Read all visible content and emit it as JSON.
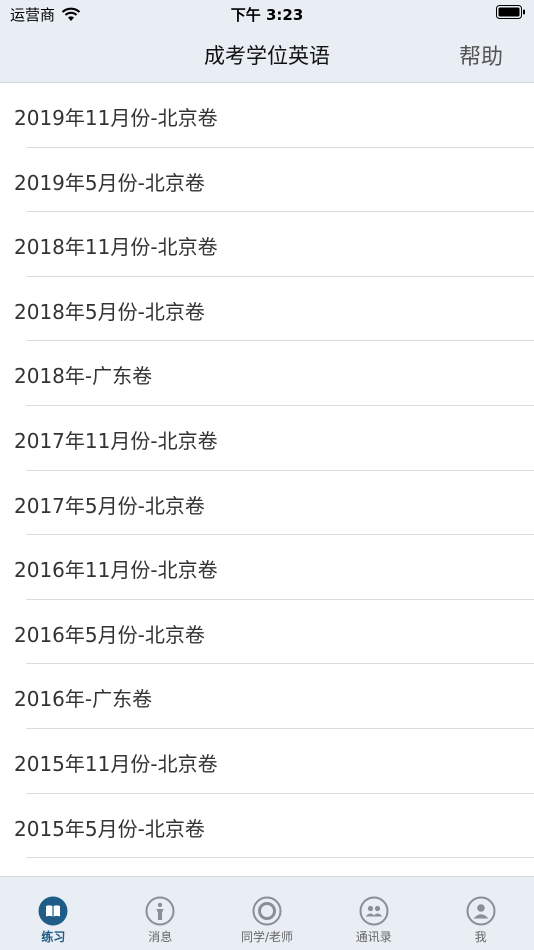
{
  "status_bar": {
    "carrier": "运营商",
    "time": "下午 3:23"
  },
  "nav": {
    "title": "成考学位英语",
    "help_label": "帮助"
  },
  "list": [
    {
      "label": "2019年11月份-北京卷"
    },
    {
      "label": "2019年5月份-北京卷"
    },
    {
      "label": "2018年11月份-北京卷"
    },
    {
      "label": "2018年5月份-北京卷"
    },
    {
      "label": "2018年-广东卷"
    },
    {
      "label": "2017年11月份-北京卷"
    },
    {
      "label": "2017年5月份-北京卷"
    },
    {
      "label": "2016年11月份-北京卷"
    },
    {
      "label": "2016年5月份-北京卷"
    },
    {
      "label": "2016年-广东卷"
    },
    {
      "label": "2015年11月份-北京卷"
    },
    {
      "label": "2015年5月份-北京卷"
    }
  ],
  "tabs": [
    {
      "label": "练习",
      "icon": "book-icon",
      "active": true
    },
    {
      "label": "消息",
      "icon": "person-info-icon",
      "active": false
    },
    {
      "label": "同学/老师",
      "icon": "target-icon",
      "active": false
    },
    {
      "label": "通讯录",
      "icon": "contacts-icon",
      "active": false
    },
    {
      "label": "我",
      "icon": "profile-icon",
      "active": false
    }
  ],
  "colors": {
    "accent": "#1f5d88",
    "bar_background": "#e9eef5",
    "inactive_icon": "#8a8f96"
  }
}
